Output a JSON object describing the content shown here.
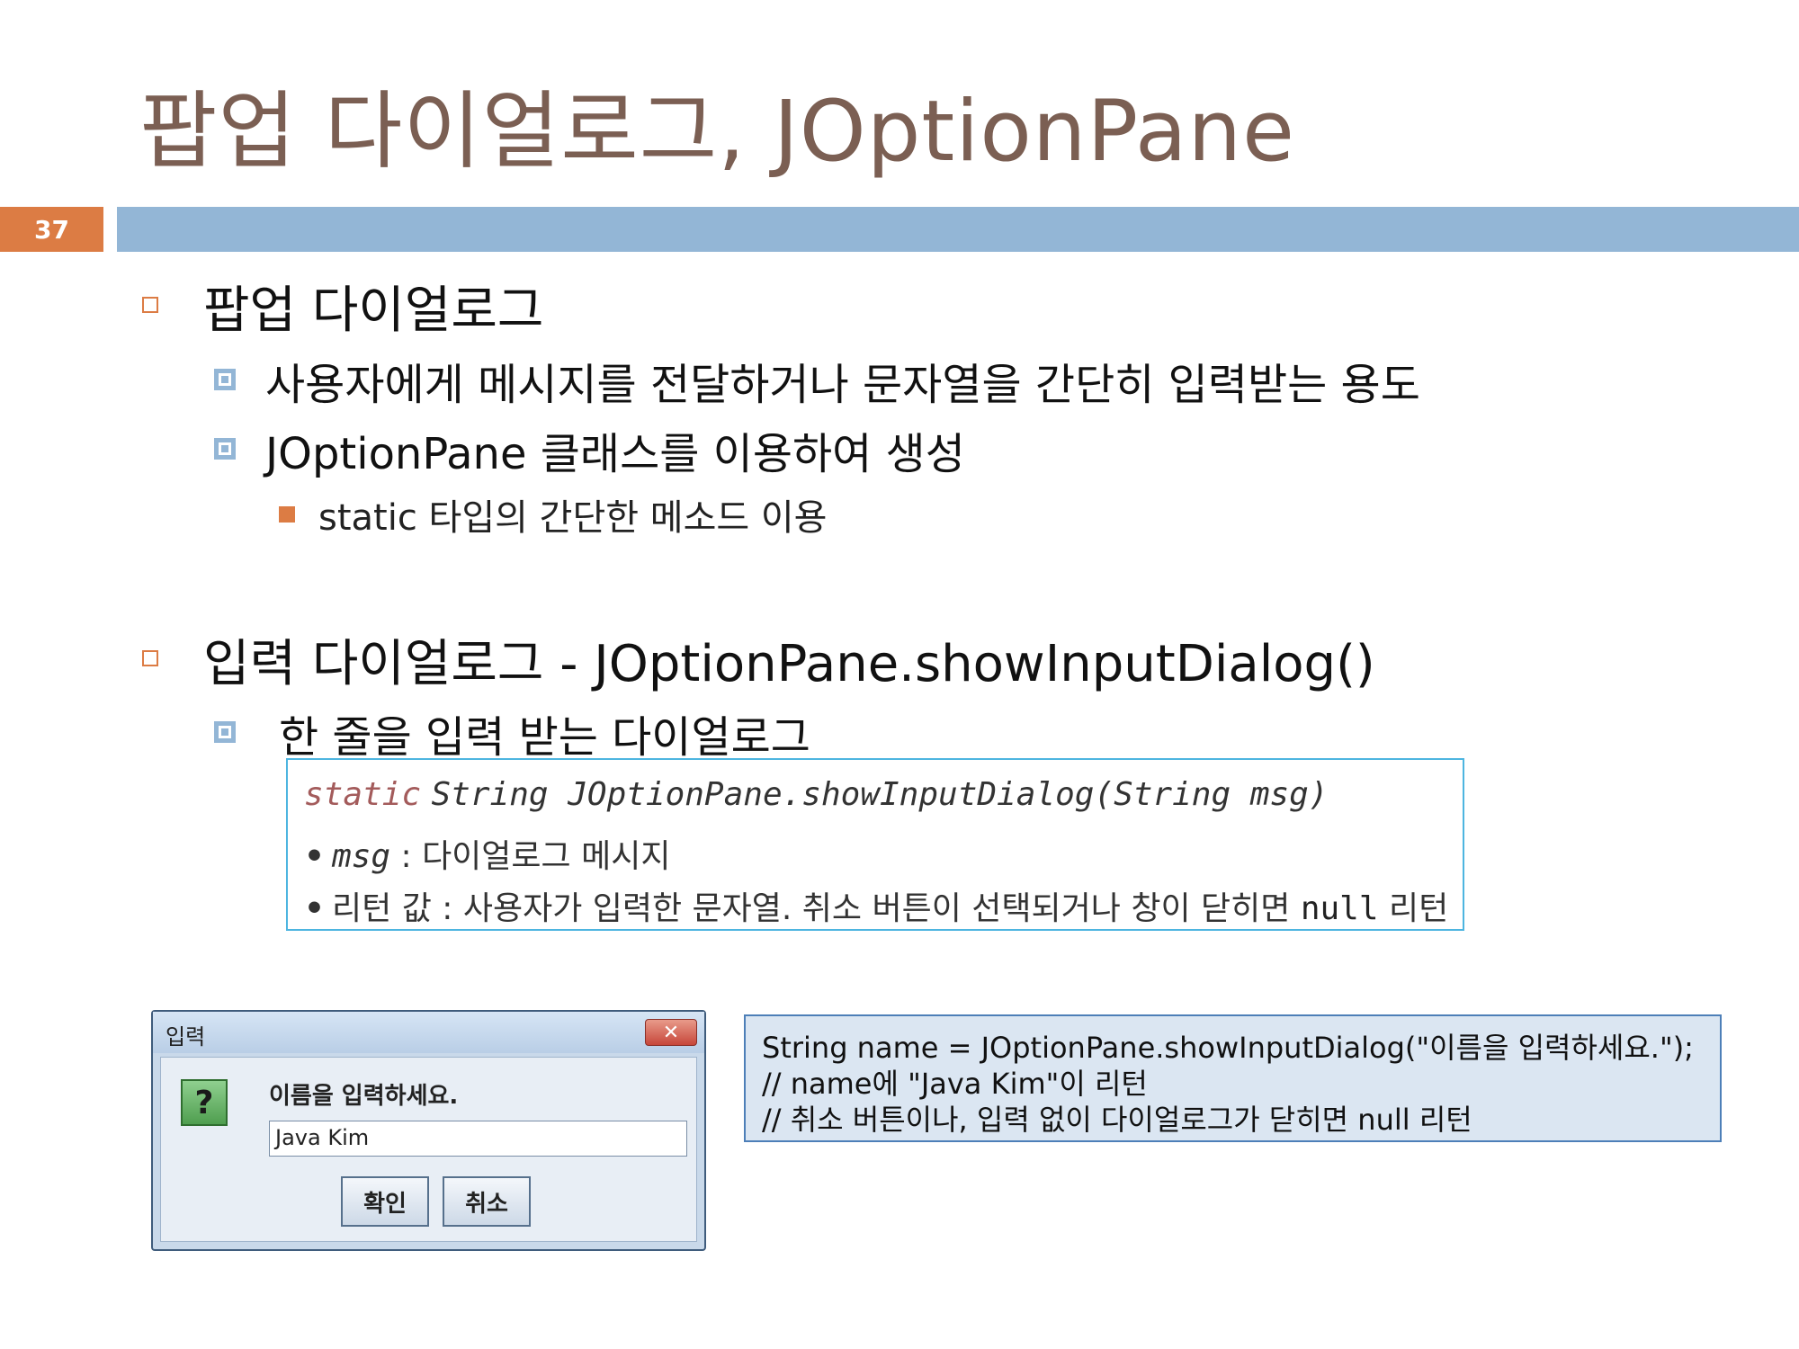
{
  "slide": {
    "title": "팝업 다이얼로그, JOptionPane",
    "page_number": "37"
  },
  "section1": {
    "heading": "팝업 다이얼로그",
    "sub1": "사용자에게 메시지를 전달하거나 문자열을 간단히 입력받는 용도",
    "sub2": "JOptionPane 클래스를 이용하여 생성",
    "sub2_detail": "static 타입의 간단한 메소드 이용"
  },
  "section2": {
    "heading": "입력 다이얼로그 - JOptionPane.showInputDialog()",
    "sub1": "한 줄을 입력 받는 다이얼로그"
  },
  "signature_box": {
    "keyword": "static",
    "signature": "String JOptionPane.showInputDialog(String msg)",
    "param_name": "msg",
    "param_sep": " : ",
    "param_desc": "다이얼로그 메시지",
    "return_label": "리턴 값 : 사용자가 입력한 문자열. 취소 버튼이 선택되거나 창이 닫히면 ",
    "return_null": "null",
    "return_suffix": " 리턴",
    "bullet": "•"
  },
  "dialog": {
    "title": "입력",
    "close_glyph": "✕",
    "question_glyph": "?",
    "message": "이름을 입력하세요.",
    "input_value": "Java Kim",
    "ok_label": "확인",
    "cancel_label": "취소"
  },
  "code_box": {
    "line1": "String name = JOptionPane.showInputDialog(\"이름을 입력하세요.\");",
    "line2": "// name에 \"Java Kim\"이 리턴",
    "line3": "// 취소 버튼이나, 입력 없이 다이얼로그가 닫히면 null 리턴"
  },
  "colors": {
    "title": "#7b5f53",
    "accent_orange": "#dc7c44",
    "header_bar": "#93b6d6",
    "signature_border": "#4db5e0",
    "code_box_bg": "#dbe6f2"
  }
}
